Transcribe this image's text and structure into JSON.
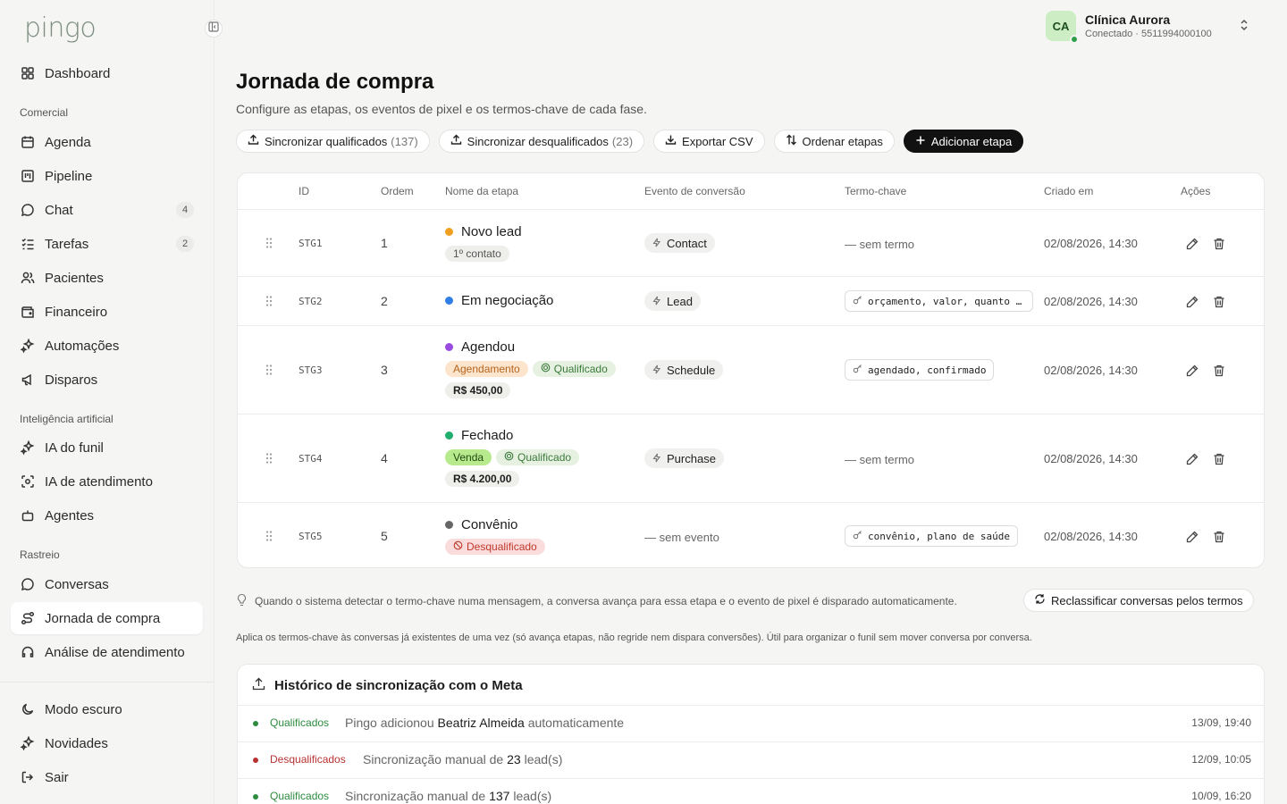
{
  "app": {
    "logo": "pingo"
  },
  "sidebar": {
    "dashboard": "Dashboard",
    "sections": {
      "comercial": "Comercial",
      "ia": "Inteligência artificial",
      "rastreio": "Rastreio"
    },
    "comercial": [
      {
        "label": "Agenda",
        "icon": "calendar-icon"
      },
      {
        "label": "Pipeline",
        "icon": "kanban-icon"
      },
      {
        "label": "Chat",
        "icon": "chat-icon",
        "badge": "4"
      },
      {
        "label": "Tarefas",
        "icon": "tasks-icon",
        "badge": "2"
      },
      {
        "label": "Pacientes",
        "icon": "users-icon"
      },
      {
        "label": "Financeiro",
        "icon": "wallet-icon"
      },
      {
        "label": "Automações",
        "icon": "sparkles-icon"
      },
      {
        "label": "Disparos",
        "icon": "megaphone-icon"
      }
    ],
    "ia": [
      {
        "label": "IA do funil",
        "icon": "sparkles-icon"
      },
      {
        "label": "IA de atendimento",
        "icon": "scan-face-icon"
      },
      {
        "label": "Agentes",
        "icon": "bot-icon"
      }
    ],
    "rastreio": [
      {
        "label": "Conversas",
        "icon": "chat-icon"
      },
      {
        "label": "Jornada de compra",
        "icon": "route-icon"
      },
      {
        "label": "Análise de atendimento",
        "icon": "headset-icon"
      }
    ],
    "footer": [
      {
        "label": "Modo escuro",
        "icon": "moon-icon"
      },
      {
        "label": "Novidades",
        "icon": "sparkles-icon"
      },
      {
        "label": "Sair",
        "icon": "logout-icon"
      }
    ]
  },
  "account": {
    "initials": "CA",
    "name": "Clínica Aurora",
    "status": "Conectado · 5511994000100"
  },
  "header": {
    "title": "Jornada de compra",
    "subtitle": "Configure as etapas, os eventos de pixel e os termos-chave de cada fase."
  },
  "toolbar": {
    "sync_qual": "Sincronizar qualificados",
    "sync_qual_count": "(137)",
    "sync_disq": "Sincronizar desqualificados",
    "sync_disq_count": "(23)",
    "export": "Exportar CSV",
    "order": "Ordenar etapas",
    "add": "Adicionar etapa"
  },
  "table": {
    "columns": [
      "ID",
      "Ordem",
      "Nome da etapa",
      "Evento de conversão",
      "Termo-chave",
      "Criado em",
      "Ações"
    ],
    "rows": [
      {
        "id": "STG1",
        "order": "1",
        "name": "Novo lead",
        "color": "#f0a020",
        "chips": [
          "1º contato"
        ],
        "event": "Contact",
        "term": "— sem termo",
        "created": "02/08/2026, 14:30"
      },
      {
        "id": "STG2",
        "order": "2",
        "name": "Em negociação",
        "color": "#2f7fe6",
        "event": "Lead",
        "term": "orçamento, valor, quanto …",
        "created": "02/08/2026, 14:30"
      },
      {
        "id": "STG3",
        "order": "3",
        "name": "Agendou",
        "color": "#9a4be0",
        "chips": [
          "Agendamento",
          "Qualificado"
        ],
        "price": "R$ 450,00",
        "event": "Schedule",
        "term": "agendado, confirmado",
        "created": "02/08/2026, 14:30"
      },
      {
        "id": "STG4",
        "order": "4",
        "name": "Fechado",
        "color": "#1fae6e",
        "chips": [
          "Venda",
          "Qualificado"
        ],
        "price": "R$ 4.200,00",
        "event": "Purchase",
        "term": "— sem termo",
        "created": "02/08/2026, 14:30"
      },
      {
        "id": "STG5",
        "order": "5",
        "name": "Convênio",
        "color": "#666666",
        "chips": [
          "Desqualificado"
        ],
        "event": "— sem evento",
        "term": "convênio, plano de saúde",
        "created": "02/08/2026, 14:30"
      }
    ]
  },
  "hint": {
    "text": "Quando o sistema detectar o termo-chave numa mensagem, a conversa avança para essa etapa e o evento de pixel é disparado automaticamente.",
    "reclassify": "Reclassificar conversas pelos termos",
    "applies": "Aplica os termos-chave às conversas já existentes de uma vez (só avança etapas, não regride nem dispara conversões). Útil para organizar o funil sem mover conversa por conversa."
  },
  "history": {
    "title": "Histórico de sincronização com o Meta",
    "rows": [
      {
        "tag": "Qualificados",
        "color": "#2e8b3e",
        "pre": "Pingo adicionou",
        "bold": "Beatriz Almeida",
        "post": "automaticamente",
        "ts": "13/09, 19:40"
      },
      {
        "tag": "Desqualificados",
        "color": "#b83232",
        "pre": "Sincronização manual de",
        "bold": "23",
        "post": "lead(s)",
        "ts": "12/09, 10:05"
      },
      {
        "tag": "Qualificados",
        "color": "#2e8b3e",
        "pre": "Sincronização manual de",
        "bold": "137",
        "post": "lead(s)",
        "ts": "10/09, 16:20"
      }
    ]
  }
}
